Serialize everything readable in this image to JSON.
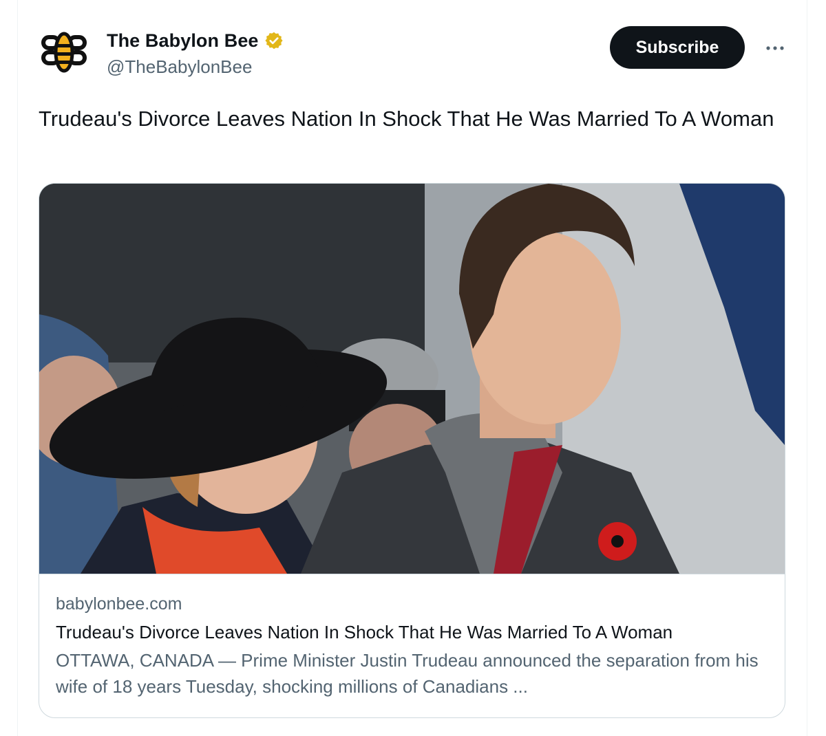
{
  "account": {
    "display_name": "The Babylon Bee",
    "handle": "@TheBabylonBee",
    "verified": true,
    "verified_color": "#e2b719",
    "avatar_icon": "babylon-bee-logo-icon"
  },
  "actions": {
    "subscribe_label": "Subscribe",
    "more_icon": "more-horizontal-icon"
  },
  "tweet": {
    "text": "Trudeau's Divorce Leaves Nation In Shock That He Was Married To A Woman"
  },
  "link_card": {
    "image_icon": "article-photo",
    "domain": "babylonbee.com",
    "title": "Trudeau's Divorce Leaves Nation In Shock That He Was Married To A Woman",
    "description": "OTTAWA, CANADA — Prime Minister Justin Trudeau announced the separation from his wife of 18 years Tuesday, shocking millions of Canadians ..."
  },
  "colors": {
    "text_primary": "#0f1419",
    "text_secondary": "#536471",
    "border": "#cfd9de",
    "button_bg": "#0f1419",
    "button_text": "#ffffff"
  }
}
